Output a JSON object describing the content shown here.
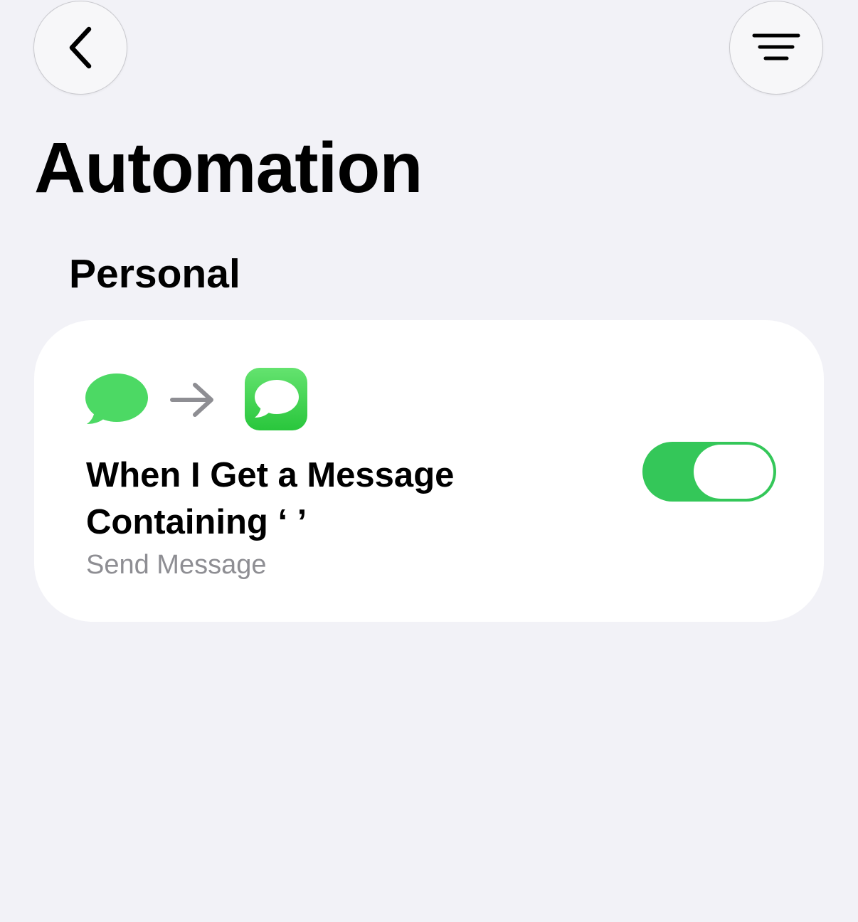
{
  "nav": {
    "back_icon": "chevron-left-icon",
    "menu_icon": "filter-lines-icon"
  },
  "page": {
    "title": "Automation"
  },
  "section": {
    "header": "Personal"
  },
  "automations": [
    {
      "trigger_icon": "message-bubble-icon",
      "arrow_icon": "arrow-right-icon",
      "action_app_icon": "messages-app-icon",
      "title": "When I Get a Message Containing ‘ ’",
      "subtitle": "Send Message",
      "enabled": true
    }
  ],
  "colors": {
    "background": "#f2f2f7",
    "card": "#ffffff",
    "toggle_on": "#34c759",
    "bubble_green": "#4cd964",
    "subtitle_gray": "#8e8e93"
  }
}
